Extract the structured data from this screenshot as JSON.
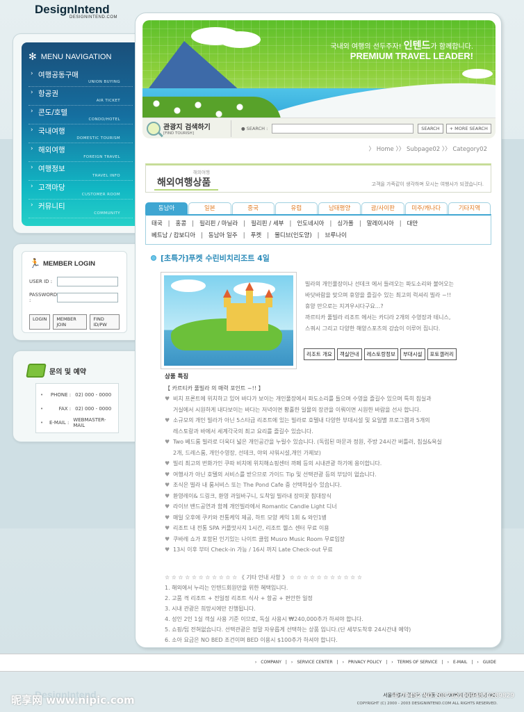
{
  "header": {
    "logo": "DesignIntend",
    "logo_sub": "DESIGNINTEND.COM"
  },
  "menu": {
    "title": "MENU NAVIGATION",
    "items": [
      {
        "label": "여행공동구매",
        "sub": "UNION BUYING"
      },
      {
        "label": "항공권",
        "sub": "AIR TICKET"
      },
      {
        "label": "콘도/호텔",
        "sub": "CONDO/HOTEL"
      },
      {
        "label": "국내여행",
        "sub": "DOMESTIC TOURISM"
      },
      {
        "label": "해외여행",
        "sub": "FOREIGN TRAVEL"
      },
      {
        "label": "여행정보",
        "sub": "TRAVEL INFO"
      },
      {
        "label": "고객마당",
        "sub": "CUSTOMER ROOM"
      },
      {
        "label": "커뮤니티",
        "sub": "COMMUNITY"
      }
    ]
  },
  "login": {
    "title": "MEMBER LOGIN",
    "user_id_label": "USER ID :",
    "password_label": "PASSWORD :",
    "buttons": [
      "LOGIN",
      "MEMBER JOIN",
      "FIND ID/PW"
    ]
  },
  "contact": {
    "title": "문의 및 예약",
    "rows": [
      {
        "key": "PHONE :",
        "value": "02) 000 - 0000"
      },
      {
        "key": "FAX :",
        "value": "02) 000 - 0000"
      },
      {
        "key": "E-MAIL :",
        "value": "WEBMASTER-MAIL"
      }
    ]
  },
  "banner": {
    "ko_prefix": "국내외 여행의 선두주자! ",
    "ko_brand": "인텐드",
    "ko_suffix": "가 함께합니다.",
    "en": "PREMIUM TRAVEL LEADER!"
  },
  "search": {
    "title": "관광지 검색하기",
    "title_sub": "[FIND TOURISH]",
    "label": "● SEARCH :",
    "value": "",
    "button": "SEARCH",
    "more_button": "+ MORE SEARCH"
  },
  "breadcrumb": [
    "Home",
    "Subpage02",
    "Category02"
  ],
  "page_title": {
    "small": "해외여행",
    "big": "해외여행상품",
    "desc": "고객을 가족같이 생각하며 모시는 여행사가 되겠습니다."
  },
  "tabs": [
    "동남아",
    "일본",
    "중국",
    "유럽",
    "남태평양",
    "괌/사이판",
    "미주/캐나다",
    "기타지역"
  ],
  "cities_line1": [
    "태국",
    "홍콩",
    "필리핀 / 마닐라",
    "필리핀 / 세부",
    "인도네시아",
    "싱가폴",
    "말레이시아",
    "대만"
  ],
  "cities_line2": [
    "베트남 / 캄보디아",
    "동남아 일주",
    "푸켓",
    "몰디브(인도양)",
    "브루나이"
  ],
  "product": {
    "title": "[초특가]푸켓 수린비치리조트 4일",
    "intro": [
      "빌라의 개인풀장이나 선데크 에서 들려오는 파도소리와 불어오는",
      "바닷바람을 맞으며 휴양을 즐길수 있는 최고의 럭셔리 빌라 ~!!",
      "휴양 만으로는 지겨우시다구요...?",
      "까르티카 풀빌라 리조트 에서는 카디라 2개의 수영장과 테니스,",
      "스쿼시 그리고 다양한 해양스포츠의 강습이 이루어 집니다."
    ],
    "buttons": [
      "리조트 개요",
      "객실안내",
      "레스토랑정보",
      "부대시설",
      "포토갤러리"
    ]
  },
  "features": {
    "heading": "상품 특징",
    "subheading": "【 카르티카 풀빌라 의 매력 포인트 ~!! 】",
    "items": [
      [
        "비치 프론트에 위치하고 있어 바다가 보이는 개인풀장에서 파도소리를 들으며 수영을 즐길수 있으며 특히 침실과",
        "거실에서 시원하게 내다보이는 바다는 저녁이면 황홀한  일몰의 장관을 이뤄이면 시원한 바람을 선사 합니다."
      ],
      [
        "소규모의 개인 빌라가 아닌 5스타급 리조트에 있는 빌라로 호텔내 다양한 부대시설 및 요일별 프로그램과 5개의",
        "레스토랑과 바에서 세계각국의 최고 요리를 즐길수 있습니다."
      ],
      [
        "Two 베드룸 빌라로 더욱더 넓은 개인공간을 누릴수 있습니다. (독립된 마문과 정원, 주방 24시간 버틀러, 침실&욕실",
        "2개, 드레스룸, 개인수영장, 선데크, 야외 샤워시설,개인 가제보)"
      ],
      [
        "빌리 최고의 번화가인 쿠따 비치에 위치해쇼핑센터 까페 등의 시내관광 하기에 용이합니다."
      ],
      [
        "여행사가 아닌 호텔의 서비스를 받으므로 가이드 Tip 및 선택관광 등의 부담이 없습니다."
      ],
      [
        "조식은 빌라 내 룸서비스 또는 The Pond Cafe 중 선택하실수 있습니다."
      ],
      [
        "환영레이& 드링크, 환영 과일바구니, 도착일 빌라내 장미꽃 침대장식"
      ],
      [
        "라이브 밴드공연과 함께 개인빌라에서 Romantic Candle Light 디너"
      ],
      [
        "매일 오후에 쿠키와 전통케익 제공, 하트 모양 케익 1회 & 와인1병"
      ],
      [
        "리조트 내 전통 SPA 커플맛사지 1시간,  리조트 헬스 센터 무료 이용"
      ],
      [
        "쿠바레 쇼가 포함된 인기있는 나이트 클럽 Musro Music Room 무료입장"
      ],
      [
        "13시 이후 부터 Check-in 가능 / 16시 까지 Late Check-out 무료"
      ]
    ]
  },
  "notes": [
    "☆ ☆ ☆ ☆ ☆ ☆ ☆ ☆ ☆ ☆ ☆ 《 기타 안내 사항 》 ☆ ☆ ☆ ☆ ☆ ☆ ☆ ☆ ☆ ☆ ☆",
    "1. 해외에서 누리는 인텐드회원만을 위한 혜택입니다.",
    "2. 고품 격 리조트 + 전일정 리조트 식사 + 항공 + 편안한 일정",
    "3. 시내 관광은 희망시에만 진행됩니다.",
    "4. 성인 2인 1실 객실 사용 기준 이므로, 독실 사용시 ₩240,000추가 하셔야 합니다.",
    "5. 쇼핑/팁 전혀없습니다. 선택관광은 정말 자유롭게 선택하는 상품 입니다.(단 세부도착후 24시간내 예약)",
    "6. 소아 요금은 NO BED 조건이며 BED 이용시 $100추가 하셔야 합니다."
  ],
  "footer": {
    "links": [
      "COMPANY",
      "SERVICE CENTER",
      "PRIVACY POLICY",
      "TERMS OF SERVICE",
      "E-MAIL",
      "GUIDE"
    ],
    "logo": "DesignIntend",
    "address": "서울특별시 강남구 신사동 000-00번지 인텐드빌딩 NO:",
    "copyright": "COPYRIGHT (C) 2000 - 2003 DESIGNINTEND.COM  ALL RIGHTS RESERVED.",
    "watermark": "昵享网 www.nipic.com",
    "watermark_id": "ID:79482 NO:20071210094850289829"
  }
}
